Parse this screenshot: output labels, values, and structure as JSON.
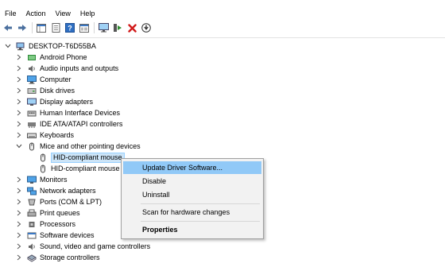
{
  "menubar": {
    "items": [
      "File",
      "Action",
      "View",
      "Help"
    ]
  },
  "toolbar": {
    "buttons": [
      "back-icon",
      "forward-icon",
      "properties-grid-icon",
      "document-icon",
      "help-icon",
      "console-icon",
      "monitor-icon",
      "scan-hardware-icon",
      "uninstall-x-icon",
      "update-driver-download-icon"
    ]
  },
  "tree": {
    "root": "DESKTOP-T6D55BA",
    "items": [
      "Android Phone",
      "Audio inputs and outputs",
      "Computer",
      "Disk drives",
      "Display adapters",
      "Human Interface Devices",
      "IDE ATA/ATAPI controllers",
      "Keyboards",
      "Mice and other pointing devices",
      "HID-compliant mouse",
      "HID-compliant mouse",
      "Monitors",
      "Network adapters",
      "Ports (COM & LPT)",
      "Print queues",
      "Processors",
      "Software devices",
      "Sound, video and game controllers",
      "Storage controllers"
    ]
  },
  "context_menu": {
    "update": "Update Driver Software...",
    "disable": "Disable",
    "uninstall": "Uninstall",
    "scan": "Scan for hardware changes",
    "properties": "Properties"
  },
  "colors": {
    "selection": "#cce4f7",
    "menu_highlight": "#91c9f7",
    "uninstall_red": "#d11a1a",
    "scan_green": "#2e8b2e"
  }
}
